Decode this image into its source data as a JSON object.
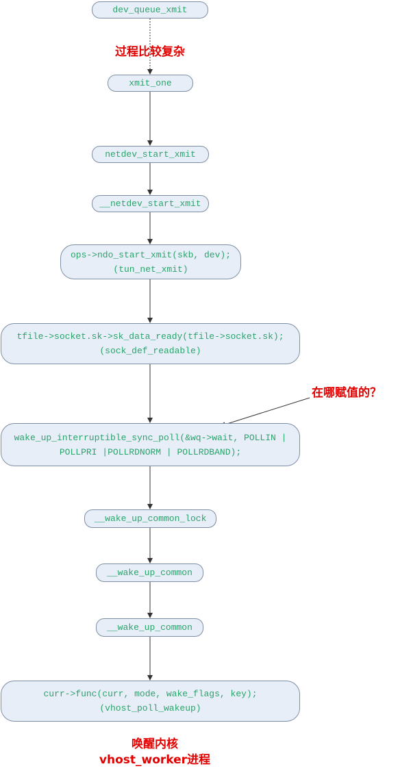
{
  "nodes": [
    {
      "line1": "dev_queue_xmit",
      "line2": ""
    },
    {
      "line1": "xmit_one",
      "line2": ""
    },
    {
      "line1": "netdev_start_xmit",
      "line2": ""
    },
    {
      "line1": "__netdev_start_xmit",
      "line2": ""
    },
    {
      "line1": "ops->ndo_start_xmit(skb, dev);",
      "line2": "(tun_net_xmit)"
    },
    {
      "line1": "tfile->socket.sk->sk_data_ready(tfile->socket.sk);",
      "line2": "(sock_def_readable)"
    },
    {
      "line1": "wake_up_interruptible_sync_poll(&wq->wait, POLLIN |",
      "line2": "POLLPRI |POLLRDNORM | POLLRDBAND);"
    },
    {
      "line1": "__wake_up_common_lock",
      "line2": ""
    },
    {
      "line1": "__wake_up_common",
      "line2": ""
    },
    {
      "line1": "__wake_up_common",
      "line2": ""
    },
    {
      "line1": "curr->func(curr, mode, wake_flags, key);",
      "line2": "(vhost_poll_wakeup)"
    }
  ],
  "notes": {
    "complex": "过程比较复杂",
    "where_assigned": "在哪赋值的？",
    "wakeup_kernel": "唤醒内核",
    "vhost_worker": "vhost_worker进程"
  },
  "colors": {
    "node_fill": "#e7eef8",
    "node_border": "#7d8da3",
    "node_text": "#2aa36b",
    "note_text": "#e00000",
    "edge": "#333333"
  }
}
